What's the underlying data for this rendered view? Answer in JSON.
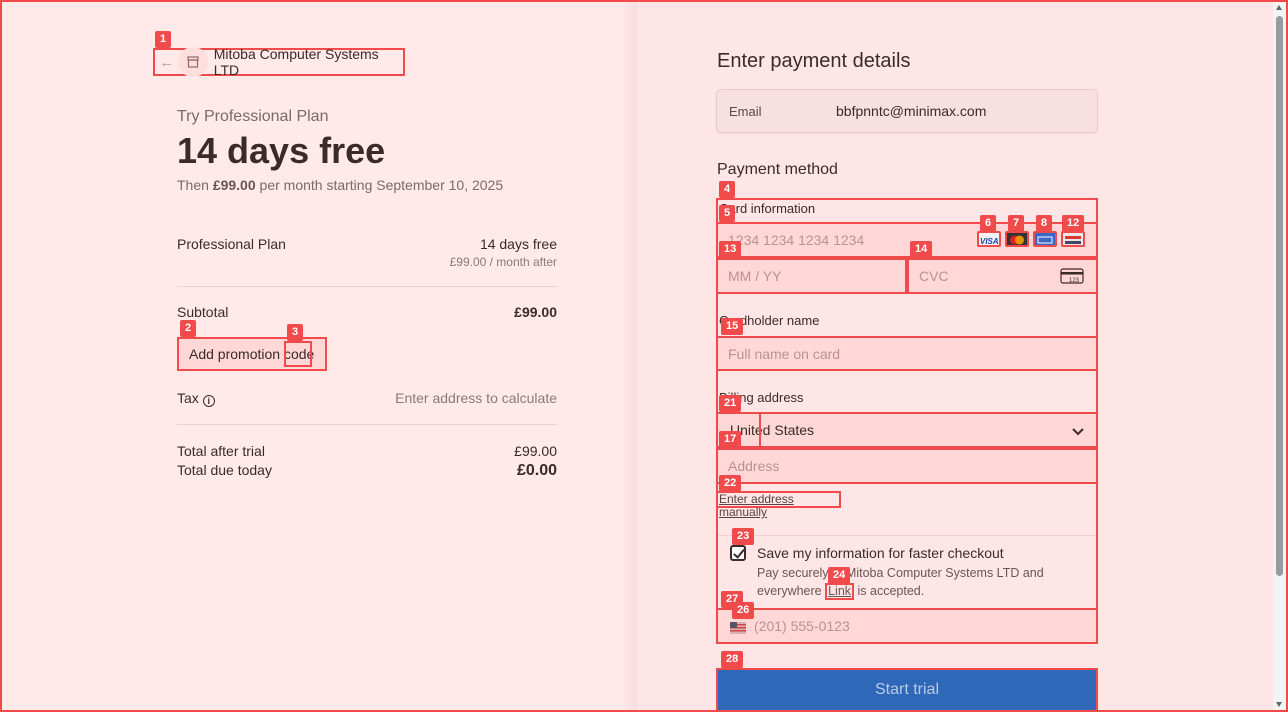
{
  "merchant": {
    "name": "Mitoba Computer Systems LTD"
  },
  "trial": {
    "try_label": "Try Professional Plan",
    "headline": "14 days free",
    "then_prefix": "Then",
    "then_price": "£99.00",
    "then_suffix": "per month starting September 10, 2025"
  },
  "summary": {
    "plan_name": "Professional Plan",
    "plan_value": "14 days free",
    "plan_sub": "£99.00 / month after",
    "subtotal_label": "Subtotal",
    "subtotal_value": "£99.00",
    "promo_label": "Add promotion code",
    "tax_label": "Tax",
    "tax_value": "Enter address to calculate",
    "total_after_label": "Total after trial",
    "total_after_value": "£99.00",
    "due_today_label": "Total due today",
    "due_today_value": "£0.00"
  },
  "payment": {
    "title": "Enter payment details",
    "email_label": "Email",
    "email_value": "bbfpnntc@minimax.com",
    "method_title": "Payment method",
    "card_info_label": "Card information",
    "card_number_placeholder": "1234 1234 1234 1234",
    "expiry_placeholder": "MM / YY",
    "cvc_placeholder": "CVC",
    "cardholder_label": "Cardholder name",
    "cardholder_placeholder": "Full name on card",
    "billing_label": "Billing address",
    "country_value": "United States",
    "address_placeholder": "Address",
    "manual_link": "Enter address manually",
    "save_title": "Save my information for faster checkout",
    "save_desc_1": "Pay securely at Mitoba Computer Systems LTD and",
    "save_desc_2_pre": "everywhere",
    "save_link": "Link",
    "save_desc_2_post": "is accepted.",
    "phone_placeholder": "(201) 555-0123",
    "cta": "Start trial"
  },
  "annotations": [
    "1",
    "2",
    "3",
    "4",
    "5",
    "6",
    "7",
    "8",
    "12",
    "13",
    "14",
    "15",
    "21",
    "17",
    "22",
    "23",
    "24",
    "27",
    "26",
    "28"
  ],
  "colors": {
    "annotation": "#f04a4a",
    "cta": "#2f68b8",
    "background": "#ffe9e9"
  }
}
